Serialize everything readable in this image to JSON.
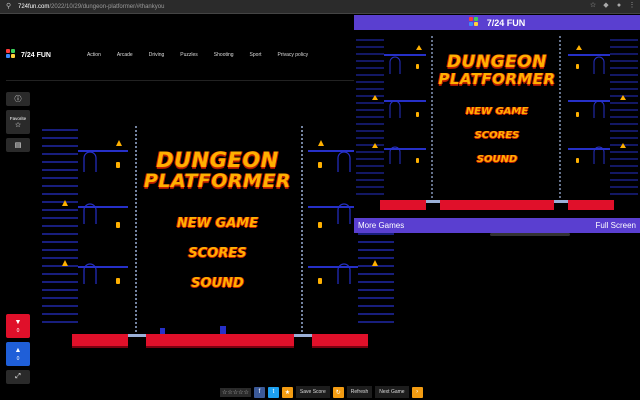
{
  "browser": {
    "url_host": "724fun.com",
    "url_path": "/2022/10/29/dungeon-platformer/#thankyou"
  },
  "site": {
    "logo_text": "7/24 FUN",
    "nav": [
      "Action",
      "Arcade",
      "Driving",
      "Puzzles",
      "Shooting",
      "Sport",
      "Privacy policy"
    ]
  },
  "side": {
    "info_icon": "info-icon",
    "favorite_label": "Favorite",
    "favorite_icon": "star-icon",
    "comment_icon": "comment-icon",
    "dislike_count": "0",
    "like_count": "0",
    "fullscreen_icon": "expand-icon"
  },
  "game": {
    "title_line1": "DUNGEON",
    "title_line2": "PLATFORMER",
    "menu": [
      "NEW GAME",
      "SCORES",
      "SOUND"
    ]
  },
  "popup": {
    "title": "7/24 FUN",
    "more_games": "More Games",
    "full_screen": "Full Screen"
  },
  "toolbar": {
    "stars": "☆☆☆☆☆",
    "save_score": "Save Score",
    "refresh": "Refresh",
    "next_game": "Next Game"
  },
  "colors": {
    "accent_purple": "#5a3fd0",
    "facebook": "#3b5998",
    "twitter": "#1da1f2",
    "orange": "#f39c12",
    "dislike_red": "#e0102a",
    "like_blue": "#1f5fd8",
    "title_gold": "#ffb000"
  }
}
